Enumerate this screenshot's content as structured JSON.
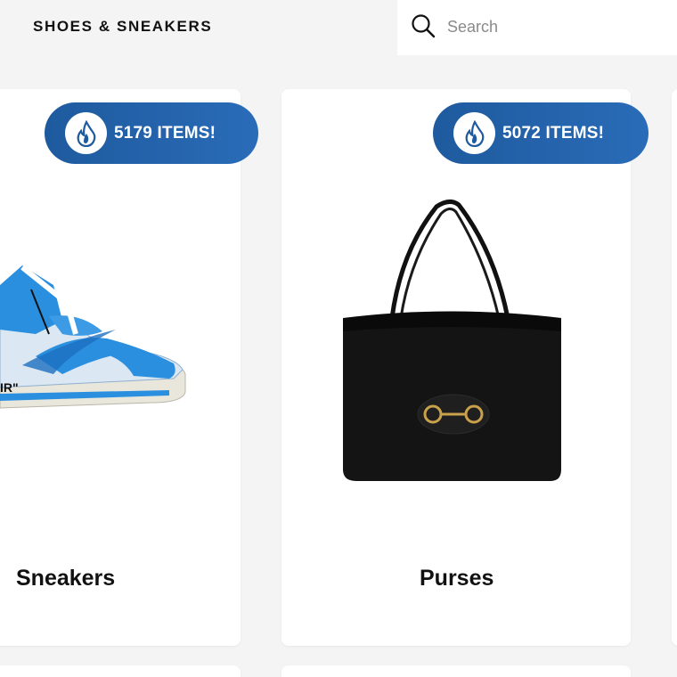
{
  "header": {
    "title": "SHOES & SNEAKERS",
    "search": {
      "placeholder": "Search",
      "value": ""
    }
  },
  "categories": [
    {
      "title": "Sneakers",
      "badge": "5179 ITEMS!",
      "image": "blue-white-high-top-sneaker"
    },
    {
      "title": "Purses",
      "badge": "5072 ITEMS!",
      "image": "black-leather-tote-bag"
    }
  ],
  "colors": {
    "badge": "#1e5a9e",
    "sneaker_blue": "#2b8fe0",
    "page_bg": "#f4f4f4"
  },
  "icons": [
    "search-icon",
    "flame-icon"
  ]
}
